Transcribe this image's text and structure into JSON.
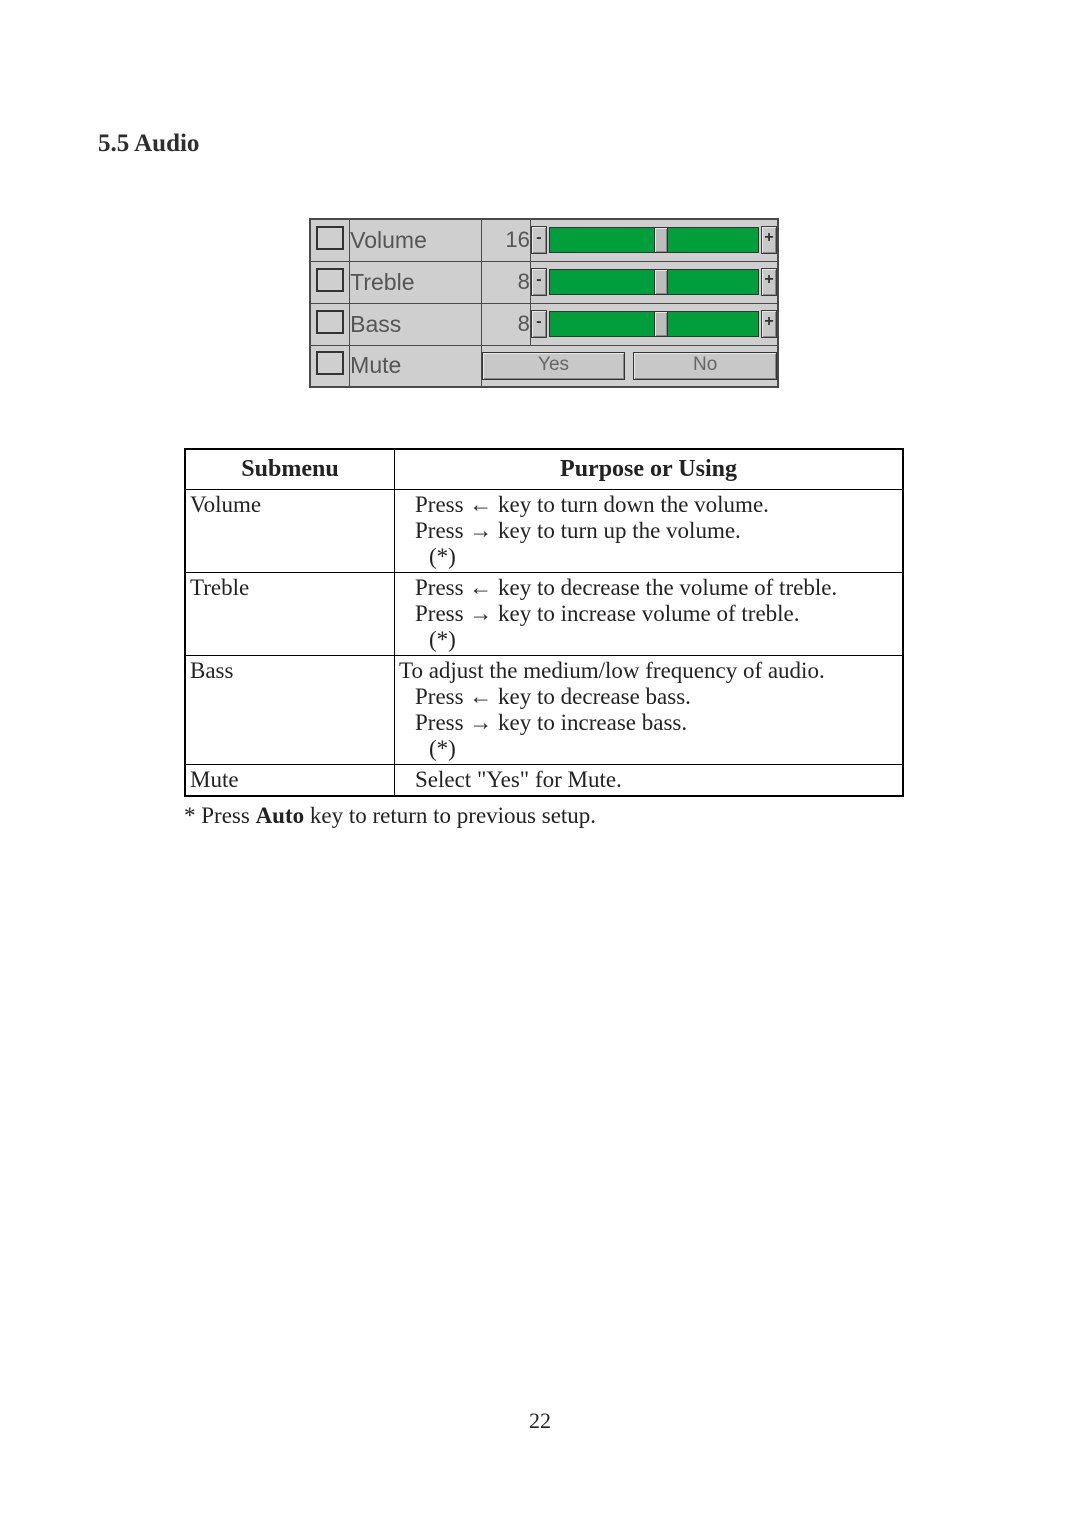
{
  "section_title": "5.5 Audio",
  "osd": {
    "rows": [
      {
        "label": "Volume",
        "value": "16",
        "thumb_pct": 50,
        "type": "slider"
      },
      {
        "label": "Treble",
        "value": "8",
        "thumb_pct": 50,
        "type": "slider"
      },
      {
        "label": "Bass",
        "value": "8",
        "thumb_pct": 50,
        "type": "slider"
      },
      {
        "label": "Mute",
        "yes": "Yes",
        "no": "No",
        "type": "buttons"
      }
    ],
    "minus": "-",
    "plus": "+"
  },
  "table": {
    "headers": {
      "submenu": "Submenu",
      "purpose": "Purpose or Using"
    },
    "rows": [
      {
        "submenu": "Volume",
        "lines": [
          "Press ← key to turn down the volume.",
          "Press → key to turn up the volume.",
          "(*)"
        ]
      },
      {
        "submenu": "Treble",
        "lines": [
          "Press ← key to decrease the volume of treble.",
          "Press → key to increase volume of treble.",
          "(*)"
        ]
      },
      {
        "submenu": "Bass",
        "lines": [
          "To adjust the medium/low frequency of audio.",
          "Press ← key to decrease bass.",
          "Press → key to increase bass.",
          "(*)"
        ],
        "first_no_indent": true
      },
      {
        "submenu": "Mute",
        "lines": [
          "Select \"Yes\" for Mute."
        ]
      }
    ]
  },
  "footnote_prefix": "* Press ",
  "footnote_bold": "Auto",
  "footnote_suffix": " key to return to previous setup.",
  "page_number": "22"
}
